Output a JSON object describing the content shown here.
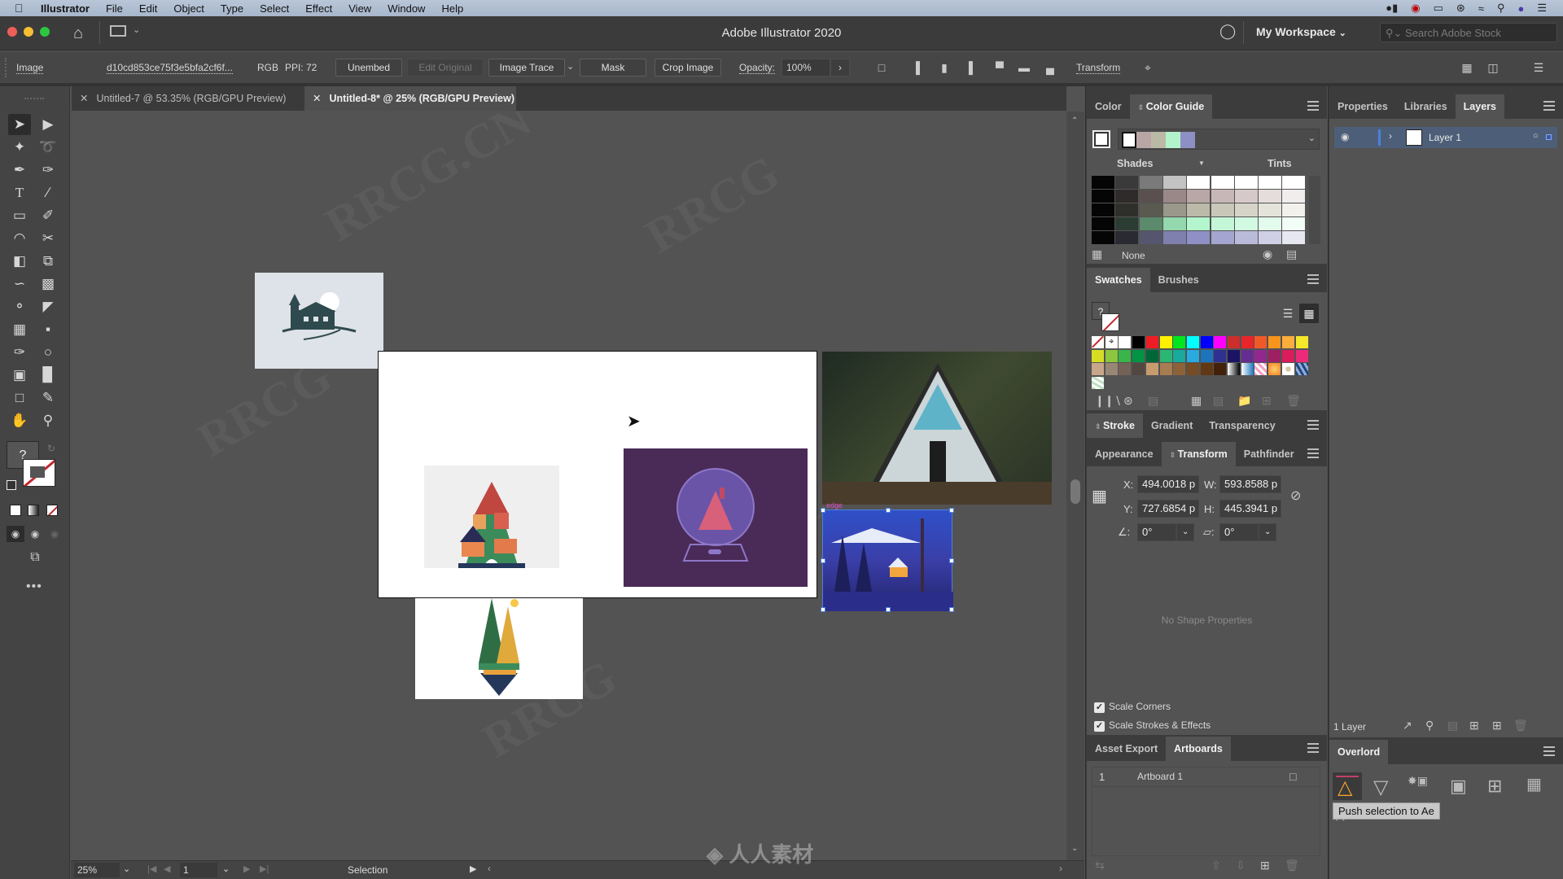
{
  "menubar": {
    "app": "Illustrator",
    "items": [
      "File",
      "Edit",
      "Object",
      "Type",
      "Select",
      "Effect",
      "View",
      "Window",
      "Help"
    ],
    "tray_icons": [
      "screen-record-icon",
      "creative-cloud-icon",
      "airplay-icon",
      "bluetooth-icon",
      "wifi-icon",
      "spotlight-icon",
      "siri-icon",
      "control-center-icon"
    ]
  },
  "appbar": {
    "title": "Adobe Illustrator 2020",
    "workspace": "My Workspace",
    "search_placeholder": "Search Adobe Stock"
  },
  "control": {
    "type": "Image",
    "filename": "d10cd853ce75f3e5bfa2cf6f...",
    "mode": "RGB",
    "ppi": "PPI: 72",
    "unembed": "Unembed",
    "edit_original": "Edit Original",
    "image_trace": "Image Trace",
    "mask": "Mask",
    "crop_image": "Crop Image",
    "opacity_label": "Opacity:",
    "opacity_value": "100%",
    "transform": "Transform"
  },
  "doc_tabs": [
    {
      "label": "Untitled-7 @ 53.35% (RGB/GPU Preview)",
      "active": false
    },
    {
      "label": "Untitled-8* @ 25% (RGB/GPU Preview)",
      "active": true
    }
  ],
  "status": {
    "zoom": "25%",
    "artboard": "1",
    "tool": "Selection"
  },
  "color_panel": {
    "tabs": [
      "Color",
      "Color Guide"
    ],
    "active_tab": "Color Guide",
    "harmony": [
      "#ffffff",
      "#b8a6a6",
      "#bcb8a6",
      "#b2f3cc",
      "#8e8fc4"
    ],
    "shades_label": "Shades",
    "tints_label": "Tints",
    "grid_rows": [
      [
        "#050505",
        "#3a3a3a",
        "#7a7a7a",
        "#c3c3c3",
        "#ffffff",
        "#ffffff",
        "#ffffff",
        "#ffffff",
        "#ffffff"
      ],
      [
        "#050505",
        "#2f2b2b",
        "#5b5050",
        "#9a8888",
        "#b9a7a7",
        "#c8b7b7",
        "#d6c9c9",
        "#e5dcdc",
        "#f1eded"
      ],
      [
        "#050505",
        "#2e2e2a",
        "#5b5a50",
        "#9a988a",
        "#bbb9a8",
        "#c9c7b8",
        "#d6d4c8",
        "#e5e4da",
        "#f2f1eb"
      ],
      [
        "#050505",
        "#2b3d33",
        "#5b8a6c",
        "#94d8ae",
        "#b3f5cd",
        "#c3f7d8",
        "#d2f9e2",
        "#e3fbec",
        "#f1fdf6"
      ],
      [
        "#050505",
        "#2a2a33",
        "#55566e",
        "#7f80ae",
        "#8f90c6",
        "#a4a5d0",
        "#babbdb",
        "#cfd0e6",
        "#e7e7f2"
      ]
    ],
    "none_label": "None"
  },
  "swatches_panel": {
    "tabs": [
      "Swatches",
      "Brushes"
    ],
    "active_tab": "Swatches",
    "rows": [
      [
        "none",
        "registration",
        "#ffffff",
        "#000000",
        "#ee1c24",
        "#fff200",
        "#00e61e",
        "#00ffff",
        "#0000ff",
        "#ff00ff",
        "#cc2e2e",
        "#e8262a",
        "#f05a28",
        "#f7941d",
        "#fbad3b",
        "#f5e82a"
      ],
      [
        "#d6de23",
        "#8dc63f",
        "#39b54a",
        "#009444",
        "#006838",
        "#2bb673",
        "#19a99d",
        "#29aae1",
        "#1c75bc",
        "#2e3192",
        "#1b1464",
        "#662d91",
        "#92278f",
        "#9e1f63",
        "#da1c5c",
        "#ed2a7a"
      ],
      [
        "#c7a68a",
        "#998675",
        "#736357",
        "#534741",
        "#c69c6d",
        "#a67c52",
        "#8c6239",
        "#754c24",
        "#603813",
        "#42210b",
        "gradient-bw",
        "gradient-blue",
        "pattern-pink",
        "gradient-orange",
        "pattern-dots",
        "pattern-blue"
      ],
      [
        "pattern-green"
      ]
    ]
  },
  "stroke_panel": {
    "tabs": [
      "Stroke",
      "Gradient",
      "Transparency"
    ],
    "active_tab": "Stroke"
  },
  "transform_panel": {
    "tabs": [
      "Appearance",
      "Transform",
      "Pathfinder"
    ],
    "active_tab": "Transform",
    "x_label": "X:",
    "x": "494.0018 p",
    "y_label": "Y:",
    "y": "727.6854 p",
    "w_label": "W:",
    "w": "593.8588 p",
    "h_label": "H:",
    "h": "445.3941 p",
    "angle": "0°",
    "shear": "0°",
    "no_shape": "No Shape Properties",
    "scale_corners": "Scale Corners",
    "scale_corners_checked": true,
    "scale_strokes": "Scale Strokes & Effects",
    "scale_strokes_checked": true
  },
  "artboards_panel": {
    "tabs": [
      "Asset Export",
      "Artboards"
    ],
    "active_tab": "Artboards",
    "rows": [
      {
        "num": "1",
        "name": "Artboard 1"
      }
    ]
  },
  "layers_panel": {
    "tabs": [
      "Properties",
      "Libraries",
      "Layers"
    ],
    "active_tab": "Layers",
    "layers": [
      {
        "name": "Layer 1",
        "color": "#4f7fdc"
      }
    ],
    "count": "1 Layer"
  },
  "overlord_panel": {
    "title": "Overlord",
    "tooltip": "Push selection to Ae",
    "accent": "#f0a030"
  },
  "canvas": {
    "selection_label": "edge"
  }
}
